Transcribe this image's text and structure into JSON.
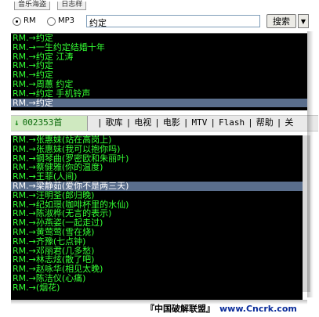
{
  "top_tabs": [
    "音乐海盗",
    "日志样"
  ],
  "search": {
    "options": [
      {
        "label": "RM",
        "selected": true
      },
      {
        "label": "MP3",
        "selected": false
      }
    ],
    "value": "约定",
    "button_label": "搜索",
    "dropdown_icon": "chevron-down-icon"
  },
  "results_list": {
    "rows": [
      "RM.→约定",
      "RM.→一生约定结婚十年",
      "RM.→约定 江涛",
      "RM.→约定",
      "RM.→约定",
      "RM.→周蕙 约定",
      "RM.→约定 手机铃声",
      "RM.→约定"
    ],
    "selected_index": 7
  },
  "navbar": {
    "home_label": "002353首",
    "home_icon": "down-arrow-icon",
    "items": [
      "歌库",
      "电视",
      "电影",
      "MTV",
      "Flash",
      "帮助",
      "关"
    ]
  },
  "song_list": {
    "rows": [
      "RM.→张惠妹(站在高岗上)",
      "RM.→张惠妹(我可以抱你吗)",
      "RM.→钢琴曲(罗密欧和朱丽叶)",
      "RM.→蔡健雅(你的温度)",
      "RM.→王菲(人间)",
      "RM.→梁静茹(爱你不是两三天)",
      "RM.→汪明荃(郎归晚)",
      "RM.→纪如璟(咖啡杯里的水仙)",
      "RM.→陈淑桦(无言的表示)",
      "RM.→孙燕姿(一起走过)",
      "RM.→黄莺莺(雪在烧)",
      "RM.→齐豫(七点钟)",
      "RM.→邓丽君(几多愁)",
      "RM.→林志炫(散了吧)",
      "RM.→赵咏华(相见太晚)",
      "RM.→陈洁仪(心痛)",
      "RM.→(烟花)"
    ],
    "selected_index": 5
  },
  "watermark": {
    "label": "『中国破解联盟』",
    "url": "www.Cncrk.com"
  },
  "colors": {
    "list_bg": "#000000",
    "list_text": "#33ff33",
    "selection": "#5a6e8c",
    "navbar_home_bg": "#cfe9c0"
  }
}
